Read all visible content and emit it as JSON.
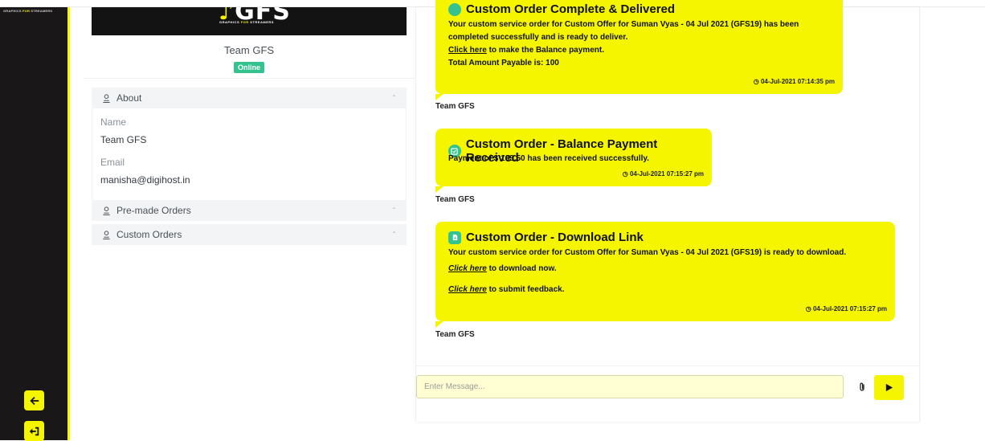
{
  "sidebar": {
    "brand_left": "GRAPHICS ",
    "brand_for": "FOR",
    "brand_right": " STREAMERS",
    "buttons": [
      {
        "icon": "arrow-left-icon"
      },
      {
        "icon": "sign-out-icon"
      }
    ]
  },
  "profile": {
    "logo_main": "GFS",
    "logo_sub_left": "GRAPHICS ",
    "logo_sub_for": "FOR",
    "logo_sub_right": " STREAMERS",
    "name": "Team GFS",
    "status": "Online",
    "status_color": "#34c38f"
  },
  "accordion": {
    "about": {
      "label": "About",
      "name_label": "Name",
      "name_value": "Team GFS",
      "email_label": "Email",
      "email_value": "manisha@digihost.in"
    },
    "premade": {
      "label": "Pre-made Orders"
    },
    "custom": {
      "label": "Custom Orders"
    }
  },
  "chat": {
    "messages": [
      {
        "title": "Custom Order Complete & Delivered",
        "line1": "Your custom service order for Custom Offer for Suman Vyas - 04 Jul 2021 (GFS19) has been",
        "line2": "completed successfully and is ready to deliver.",
        "link": "Click here",
        "link_rest": " to make the Balance payment.",
        "total": "Total Amount Payable is: 100",
        "time": "04-Jul-2021 07:14:35 pm",
        "sender": "Team GFS"
      },
      {
        "title": "Custom Order - Balance Payment Received",
        "line1": "Payment of $ 103.50 has been received successfully.",
        "time": "04-Jul-2021 07:15:27 pm",
        "sender": "Team GFS"
      },
      {
        "title": "Custom Order - Download Link",
        "line1": "Your custom service order for Custom Offer for Suman Vyas - 04 Jul 2021 (GFS19) is ready to download.",
        "link1": "Click here",
        "link1_rest": " to download now.",
        "link2": "Click here",
        "link2_rest": " to submit feedback.",
        "time": "04-Jul-2021 07:15:27 pm",
        "sender": "Team GFS"
      }
    ]
  },
  "composer": {
    "placeholder": "Enter Message...",
    "attach_icon": "paperclip-icon",
    "send_icon": "send-icon"
  },
  "colors": {
    "accent": "#f5f500",
    "sidebar_bg": "#1a1718",
    "success": "#34c38f"
  }
}
